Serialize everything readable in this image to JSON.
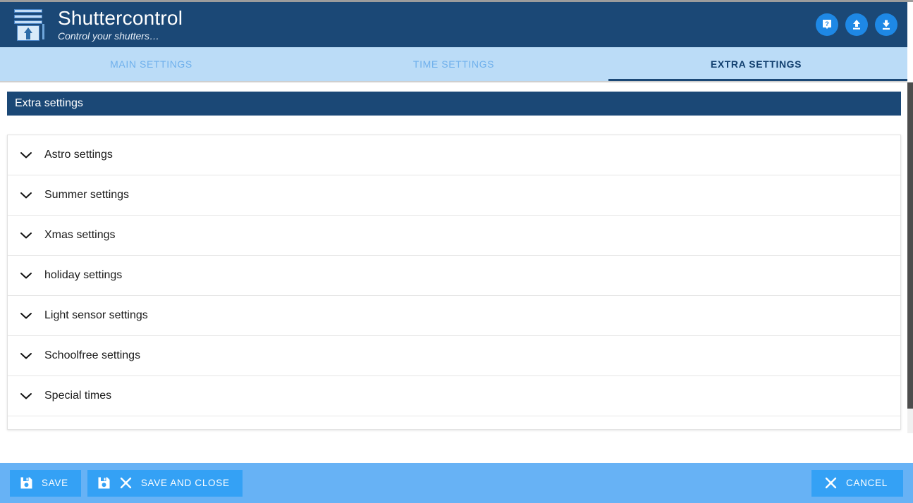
{
  "header": {
    "title": "Shuttercontrol",
    "subtitle": "Control your shutters…",
    "logo_icon": "shutter-up-icon",
    "actions": [
      {
        "name": "help-button",
        "icon": "help-book-icon"
      },
      {
        "name": "upload-button",
        "icon": "upload-arrow-icon"
      },
      {
        "name": "download-button",
        "icon": "download-arrow-icon"
      }
    ]
  },
  "tabs": [
    {
      "label": "MAIN SETTINGS",
      "active": false
    },
    {
      "label": "TIME SETTINGS",
      "active": false
    },
    {
      "label": "EXTRA SETTINGS",
      "active": true
    }
  ],
  "section": {
    "title": "Extra settings"
  },
  "accordion": {
    "chevron_icon": "chevron-down-icon",
    "items": [
      {
        "label": "Astro settings"
      },
      {
        "label": "Summer settings"
      },
      {
        "label": "Xmas settings"
      },
      {
        "label": "holiday settings"
      },
      {
        "label": "Light sensor settings"
      },
      {
        "label": "Schoolfree settings"
      },
      {
        "label": "Special times"
      }
    ]
  },
  "footer": {
    "save_label": "SAVE",
    "save_icon": "floppy-disk-icon",
    "save_and_close_label": "SAVE AND CLOSE",
    "save_and_close_icons": [
      "floppy-disk-icon",
      "close-x-icon"
    ],
    "cancel_label": "CANCEL",
    "cancel_icon": "close-x-icon"
  },
  "colors": {
    "header_bg": "#1b4876",
    "tabbar_bg": "#bbdcf7",
    "tab_active": "#12406f",
    "tab_inactive": "#6fb0ec",
    "footer_bg": "#67b2f5",
    "button_bg": "#34a1f5",
    "accent_circle": "#1e88e5"
  }
}
